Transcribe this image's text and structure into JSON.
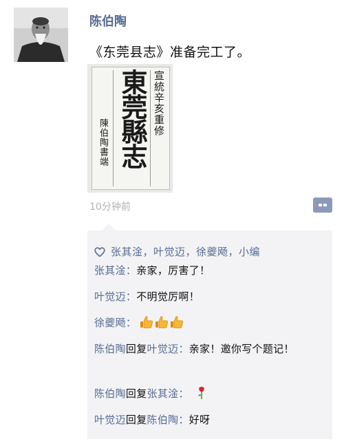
{
  "post": {
    "author": "陈伯陶",
    "text": "《东莞县志》准备完工了。",
    "time": "10分钟前",
    "photo": {
      "title": "東莞縣志",
      "side_text": "宣統辛亥重修",
      "signature": "陳伯陶書端"
    }
  },
  "likes": {
    "names": "张其淦，叶觉迈，徐夔飏，小编"
  },
  "comments": [
    {
      "name": "张其淦",
      "sep": "：",
      "text": "亲家，厉害了！"
    },
    {
      "name": "叶觉迈",
      "sep": "：",
      "text": "不明觉厉啊！"
    },
    {
      "name": "徐夔飏",
      "sep": "：",
      "emoji": "thumbs-up-icon",
      "count": 3
    },
    {
      "name": "陈伯陶",
      "reply": "回复",
      "target": "叶觉迈",
      "sep": "：",
      "text": "亲家！邀你写个题记！"
    },
    {
      "name": "陈伯陶",
      "reply": "回复",
      "target": "张其淦",
      "sep": "：",
      "emoji": "rose-icon"
    },
    {
      "name": "叶觉迈",
      "reply": "回复",
      "target": "陈伯陶",
      "sep": "：",
      "text": "好呀"
    }
  ],
  "colors": {
    "link": "#576b95",
    "comment_bg": "#f3f3f5",
    "time": "#b2b2b2",
    "action_button": "#8b9ab8"
  }
}
